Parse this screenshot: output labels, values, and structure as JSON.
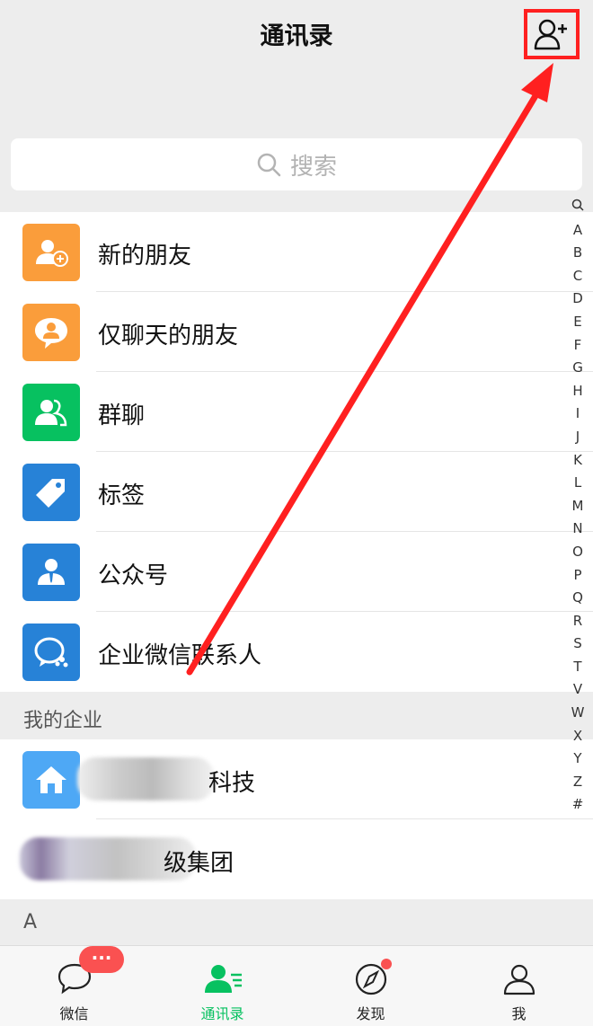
{
  "header": {
    "title": "通讯录"
  },
  "search": {
    "placeholder": "搜索"
  },
  "menu_items": [
    {
      "label": "新的朋友",
      "icon": "new-friend-icon",
      "color": "#fa9d3b"
    },
    {
      "label": "仅聊天的朋友",
      "icon": "chat-only-friend-icon",
      "color": "#fa9d3b"
    },
    {
      "label": "群聊",
      "icon": "group-chat-icon",
      "color": "#07c160"
    },
    {
      "label": "标签",
      "icon": "tag-icon",
      "color": "#2782d7"
    },
    {
      "label": "公众号",
      "icon": "official-account-icon",
      "color": "#2782d7"
    },
    {
      "label": "企业微信联系人",
      "icon": "wecom-contact-icon",
      "color": "#2782d7"
    }
  ],
  "enterprise_section": {
    "title": "我的企业",
    "items": [
      {
        "label": "科技",
        "icon": "enterprise-home-icon",
        "color": "#4ea8f5"
      },
      {
        "label": "级集团"
      }
    ]
  },
  "contacts_section": {
    "letter": "A"
  },
  "index_letters": [
    "A",
    "B",
    "C",
    "D",
    "E",
    "F",
    "G",
    "H",
    "I",
    "J",
    "K",
    "L",
    "M",
    "N",
    "O",
    "P",
    "Q",
    "R",
    "S",
    "T",
    "V",
    "W",
    "X",
    "Y",
    "Z",
    "#"
  ],
  "tabbar": {
    "tabs": [
      {
        "label": "微信",
        "icon": "chat-bubble-icon"
      },
      {
        "label": "通讯录",
        "icon": "contacts-icon"
      },
      {
        "label": "发现",
        "icon": "compass-icon"
      },
      {
        "label": "我",
        "icon": "me-icon"
      }
    ],
    "wechat_badge": "···",
    "active_color": "#07c160"
  },
  "colors": {
    "annotation": "#ff2020",
    "background": "#ededed"
  }
}
